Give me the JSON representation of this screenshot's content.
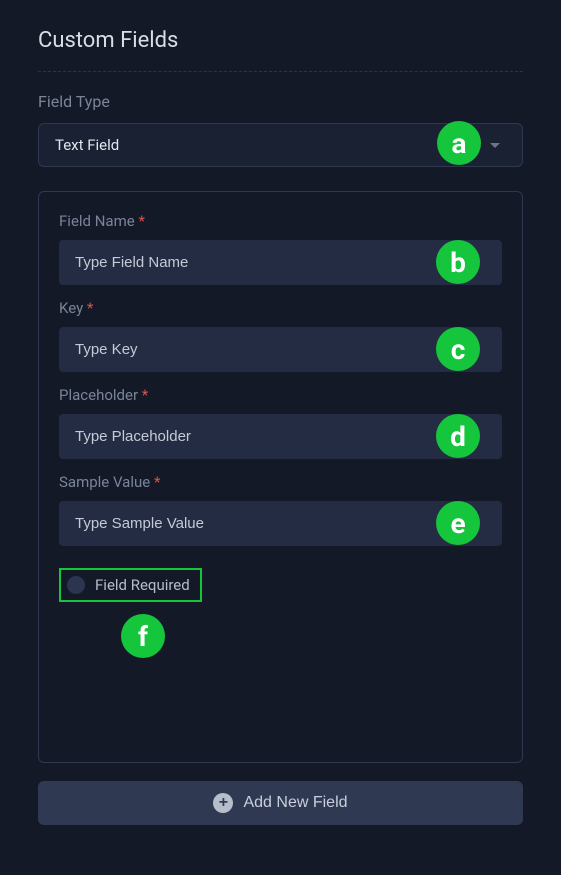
{
  "section": {
    "title": "Custom Fields"
  },
  "fieldType": {
    "label": "Field Type",
    "selected": "Text Field"
  },
  "config": {
    "fieldName": {
      "label": "Field Name",
      "placeholder": "Type Field Name"
    },
    "key": {
      "label": "Key",
      "placeholder": "Type Key"
    },
    "placeholder": {
      "label": "Placeholder",
      "placeholder": "Type Placeholder"
    },
    "sampleValue": {
      "label": "Sample Value",
      "placeholder": "Type Sample Value"
    },
    "required": {
      "label": "Field Required",
      "checked": false
    }
  },
  "addButton": {
    "label": "Add New Field"
  },
  "markers": {
    "a": "a",
    "b": "b",
    "c": "c",
    "d": "d",
    "e": "e",
    "f": "f"
  },
  "asterisk": "*"
}
